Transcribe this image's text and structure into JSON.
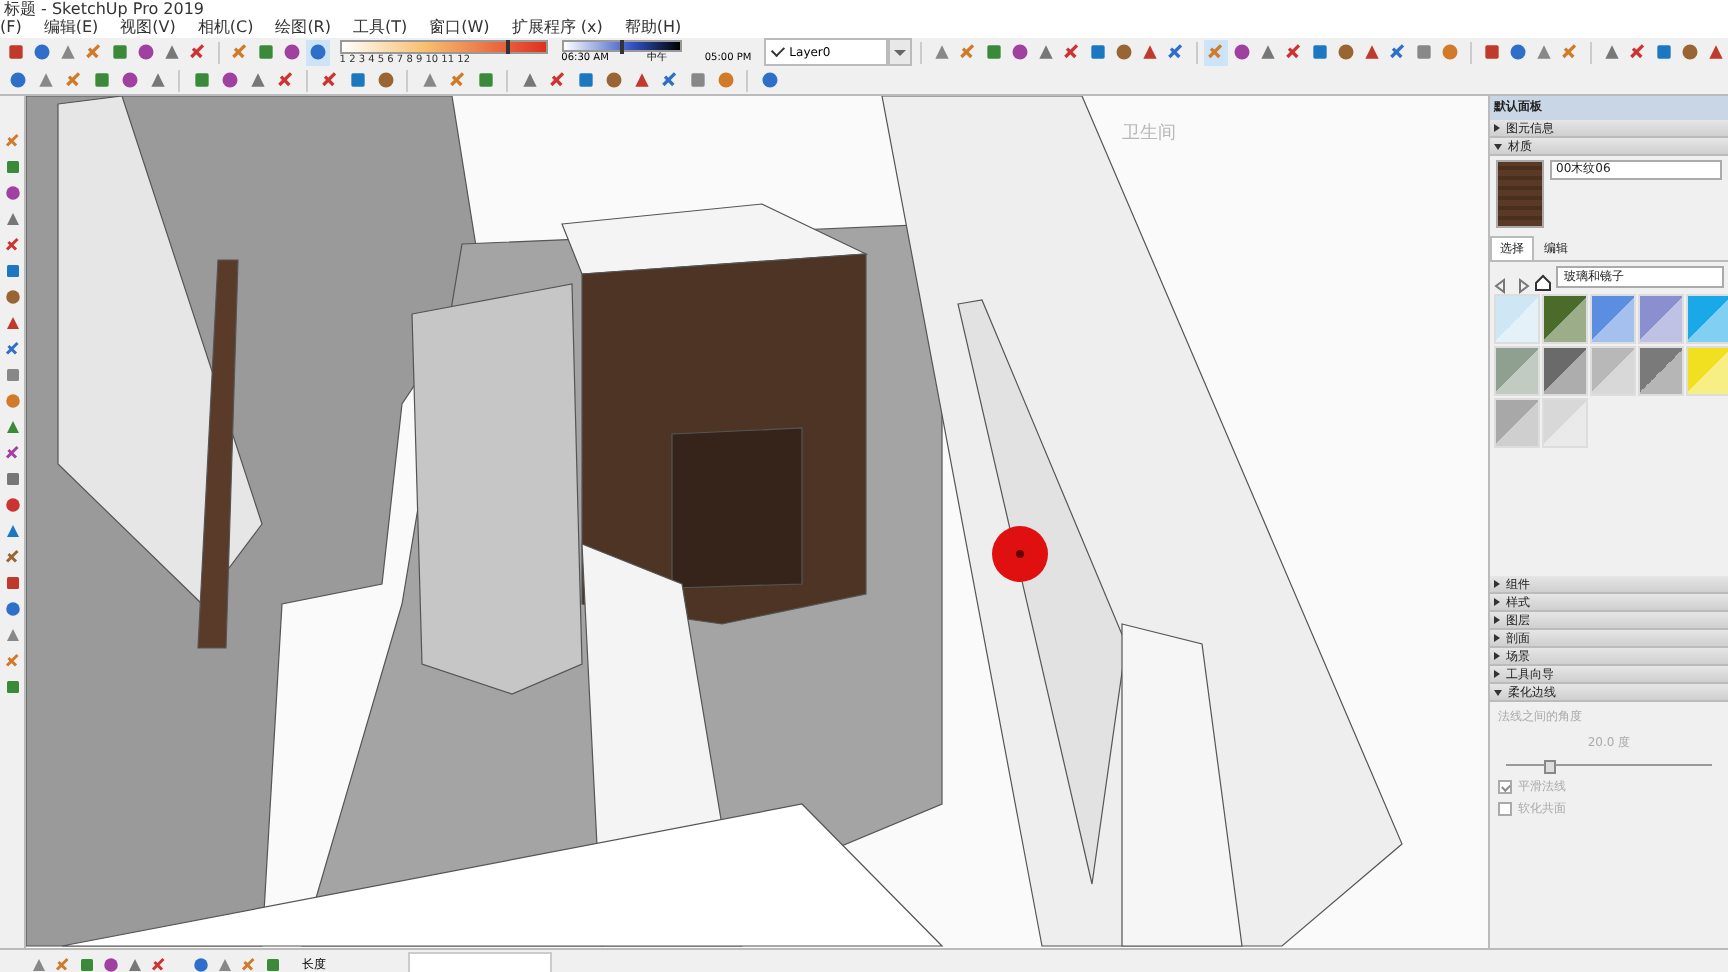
{
  "window": {
    "title": "标题 - SketchUp Pro 2019"
  },
  "menu": [
    "(F)",
    "编辑(E)",
    "视图(V)",
    "相机(C)",
    "绘图(R)",
    "工具(T)",
    "窗口(W)",
    "扩展程序 (x)",
    "帮助(H)"
  ],
  "shadow_bar": {
    "date_slider": {
      "level": 0.82
    },
    "time_slider": {
      "level": 0.5
    },
    "hours": "1 2 3 4 5 6 7 8 9 10 11 12",
    "start_time": "06:30 AM",
    "noon": "中午",
    "end_time": "05:00 PM"
  },
  "layer": {
    "value": "Layer0",
    "checked": true
  },
  "viewport": {
    "plan_label": "卫生间"
  },
  "tray": {
    "title": "默认面板",
    "sections_top": [
      {
        "label": "图元信息",
        "expanded": false
      },
      {
        "label": "材质",
        "expanded": true
      }
    ],
    "materials": {
      "name": "00木纹06",
      "tabs": [
        {
          "label": "选择",
          "selected": true
        },
        {
          "label": "编辑",
          "selected": false
        }
      ],
      "library": "玻璃和镜子",
      "swatches": [
        {
          "color": "#cfe6f4"
        },
        {
          "color": "#4a6b2a"
        },
        {
          "color": "#5b8de0"
        },
        {
          "color": "#8a8fcf"
        },
        {
          "color": "#1aa8e8"
        },
        {
          "color": "#8fa090"
        },
        {
          "color": "#6a6a6a"
        },
        {
          "color": "#b8b8b8"
        },
        {
          "color": "#7a7a7a"
        },
        {
          "color": "#f0e020"
        },
        {
          "color": "#a8a8a8"
        },
        {
          "color": "#d8d8d8"
        }
      ]
    },
    "sections_bottom": [
      {
        "label": "组件",
        "expanded": false
      },
      {
        "label": "样式",
        "expanded": false
      },
      {
        "label": "图层",
        "expanded": false
      },
      {
        "label": "剖面",
        "expanded": false
      },
      {
        "label": "场景",
        "expanded": false
      },
      {
        "label": "工具向导",
        "expanded": false
      },
      {
        "label": "柔化边线",
        "expanded": true
      }
    ],
    "soften": {
      "label": "法线之间的角度",
      "angle": "20.0 度",
      "level": 0.2,
      "options": [
        {
          "label": "平滑法线",
          "checked": true
        },
        {
          "label": "软化共面",
          "checked": false
        }
      ]
    }
  },
  "status_bar": {
    "measure_label": "长度"
  }
}
